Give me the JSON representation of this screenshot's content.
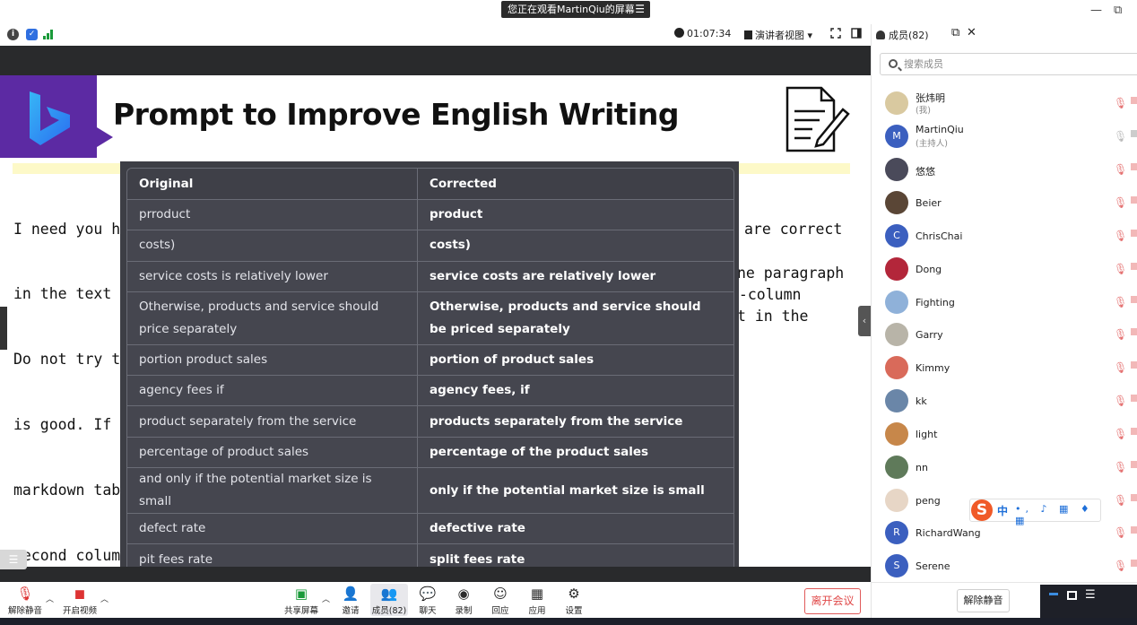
{
  "title_bar": {
    "share_notice": "您正在观看MartinQiu的屏幕",
    "share_menu_icon": "menu-lines-icon",
    "minimize": "—",
    "restore": "⧉"
  },
  "info_bar": {
    "timer": "01:07:34",
    "view_mode": "演讲者视图",
    "view_caret": "▾"
  },
  "slide": {
    "title": "Prompt to Improve English Writing",
    "left_text": [
      "I need you h",
      "in the text ",
      "Do not try t",
      "is good. If ",
      "markdown tab",
      "second colum"
    ],
    "right_text": [
      "are correct",
      "",
      "ne paragraph",
      "o-column",
      "t in the",
      ""
    ]
  },
  "table": {
    "headers": [
      "Original",
      "Corrected"
    ],
    "rows": [
      {
        "original": "prroduct",
        "corrected": "product"
      },
      {
        "original": "costs)",
        "corrected": "costs)"
      },
      {
        "original": "service costs is relatively lower",
        "corrected": "service costs are relatively lower"
      },
      {
        "original": "Otherwise, products and service should price separately",
        "corrected": "Otherwise, products and service should be priced separately"
      },
      {
        "original": "portion product sales",
        "corrected": "portion of product sales"
      },
      {
        "original": "agency fees if",
        "corrected": "agency fees, if"
      },
      {
        "original": "product separately from the service",
        "corrected": "products separately from the service"
      },
      {
        "original": "percentage of product sales",
        "corrected": "percentage of the product sales"
      },
      {
        "original": "and only if the potential market size is small",
        "corrected": "only if the potential market size is small"
      },
      {
        "original": "defect rate",
        "corrected": "defective rate"
      },
      {
        "original": "pit fees rate",
        "corrected": "split fees rate"
      }
    ]
  },
  "toolbar": {
    "unmute": "解除静音",
    "start_video": "开启视频",
    "share_screen": "共享屏幕",
    "invite": "邀请",
    "members": "成员(82)",
    "chat": "聊天",
    "record": "录制",
    "reactions": "回应",
    "apps": "应用",
    "settings": "设置",
    "leave": "离开会议"
  },
  "panel": {
    "title": "成员(82)",
    "search_placeholder": "搜索成员",
    "unmute_all": "解除静音",
    "members": [
      {
        "name": "张炜明",
        "sub": "(我)",
        "avatar_letter": "",
        "color": "#d9c9a0"
      },
      {
        "name": "MartinQiu",
        "sub": "(主持人)",
        "avatar_letter": "M",
        "color": "#3b5fbf"
      },
      {
        "name": "悠悠",
        "sub": "",
        "avatar_letter": "",
        "color": "#4a4a5a"
      },
      {
        "name": "Beier",
        "sub": "",
        "avatar_letter": "",
        "color": "#5a4636"
      },
      {
        "name": "ChrisChai",
        "sub": "",
        "avatar_letter": "C",
        "color": "#3b5fbf"
      },
      {
        "name": "Dong",
        "sub": "",
        "avatar_letter": "",
        "color": "#b3263a"
      },
      {
        "name": "Fighting",
        "sub": "",
        "avatar_letter": "",
        "color": "#8fb1d9"
      },
      {
        "name": "Garry",
        "sub": "",
        "avatar_letter": "",
        "color": "#b8b4a8"
      },
      {
        "name": "Kimmy",
        "sub": "",
        "avatar_letter": "",
        "color": "#d96a5a"
      },
      {
        "name": "kk",
        "sub": "",
        "avatar_letter": "",
        "color": "#6a86a8"
      },
      {
        "name": "light",
        "sub": "",
        "avatar_letter": "",
        "color": "#c7874a"
      },
      {
        "name": "nn",
        "sub": "",
        "avatar_letter": "",
        "color": "#5f7a5a"
      },
      {
        "name": "peng",
        "sub": "",
        "avatar_letter": "",
        "color": "#e7d6c6"
      },
      {
        "name": "RichardWang",
        "sub": "",
        "avatar_letter": "R",
        "color": "#3b5fbf"
      },
      {
        "name": "Serene",
        "sub": "",
        "avatar_letter": "S",
        "color": "#3b5fbf"
      }
    ]
  },
  "ime": {
    "logo": "S",
    "lang": "中",
    "tools": "•, ♪ ▦ ♦ ▦"
  }
}
